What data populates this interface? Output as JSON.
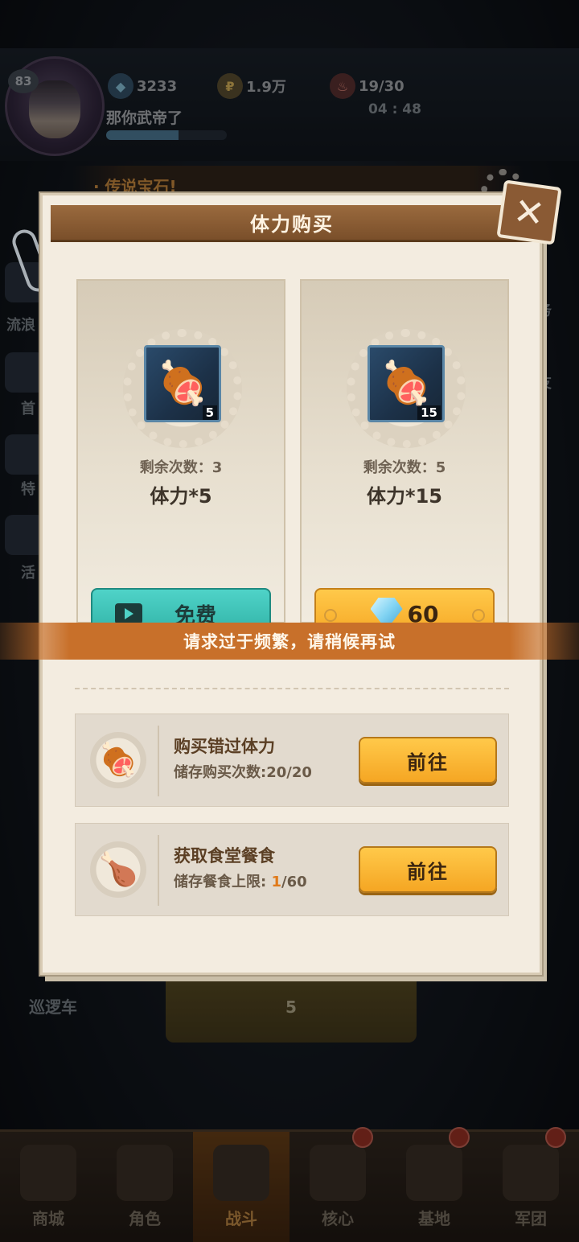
{
  "hud": {
    "level": "83",
    "gems": "3233",
    "gold": "1.9万",
    "stamina": "19/30",
    "stamina_timer": "04 : 48",
    "player_name": "那你武帝了"
  },
  "marquee": "· 传说宝石!",
  "side_menu": [
    {
      "label": "流浪"
    },
    {
      "label": "首"
    },
    {
      "label": "特"
    },
    {
      "label": "活"
    }
  ],
  "side_menu_right": [
    {
      "label": "务"
    },
    {
      "label": "友"
    }
  ],
  "start_game": {
    "cost": "5"
  },
  "patrol_label": "巡逻车",
  "bottom_nav": [
    {
      "label": "商城",
      "active": false,
      "badge": false
    },
    {
      "label": "角色",
      "active": false,
      "badge": false
    },
    {
      "label": "战斗",
      "active": true,
      "badge": false
    },
    {
      "label": "核心",
      "active": false,
      "badge": true
    },
    {
      "label": "基地",
      "active": false,
      "badge": true
    },
    {
      "label": "军团",
      "active": false,
      "badge": true
    }
  ],
  "dialog": {
    "title": "体力购买",
    "close_icon": "close-icon",
    "cards": [
      {
        "item_count": "5",
        "remaining": "剩余次数：3",
        "amount": "体力*5",
        "button_label": "免费",
        "button_type": "free-video"
      },
      {
        "item_count": "15",
        "remaining": "剩余次数：5",
        "amount": "体力*15",
        "button_label": "60",
        "button_type": "gem"
      }
    ],
    "rows": [
      {
        "title": "购买错过体力",
        "sub": "储存购买次数:20/20",
        "button": "前往",
        "icon": "meat-icon"
      },
      {
        "title": "获取食堂餐食",
        "sub_prefix": "储存餐食上限: ",
        "sub_value": "1",
        "sub_suffix": "/60",
        "button": "前往",
        "icon": "roast-dish-icon"
      }
    ]
  },
  "toast": "请求过于频繁，请稍候再试",
  "colors": {
    "accent_orange": "#f5a623",
    "teal_button": "#2fb0a4",
    "title_bar": "#7a4f2a",
    "toast": "#c8702a"
  }
}
